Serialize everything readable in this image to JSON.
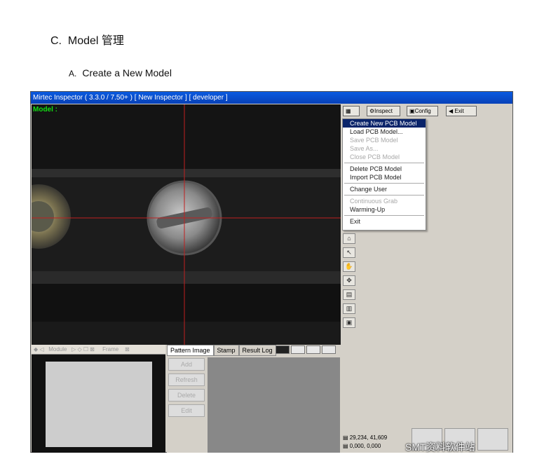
{
  "doc": {
    "heading_num": "C.",
    "heading": "Model 管理",
    "sub_letter": "A.",
    "sub": "Create a New Model"
  },
  "window": {
    "title": "Mirtec Inspector ( 3.3.0 / 7.50+ ) [ New Inspector ] [ developer ]",
    "model_label": "Model :"
  },
  "toolbar": {
    "inspect": "Inspect",
    "config": "Config",
    "exit": "Exit"
  },
  "menu": [
    {
      "label": "Create New PCB Model",
      "state": "selected"
    },
    {
      "label": "Load PCB Model...",
      "state": "enabled"
    },
    {
      "label": "Save PCB Model",
      "state": "disabled"
    },
    {
      "label": "Save As...",
      "state": "disabled"
    },
    {
      "label": "Close PCB Model",
      "state": "disabled"
    },
    {
      "label": "Delete PCB Model",
      "state": "enabled"
    },
    {
      "label": "Import PCB Model",
      "state": "enabled"
    },
    {
      "label": "Change User",
      "state": "enabled"
    },
    {
      "label": "Continuous Grab",
      "state": "disabled"
    },
    {
      "label": "Warming-Up",
      "state": "enabled"
    },
    {
      "label": "Exit",
      "state": "enabled"
    }
  ],
  "bottom_left": {
    "module": "Module",
    "frame": "Frame"
  },
  "tabs": [
    "Pattern Image",
    "Stamp",
    "Result Log"
  ],
  "side_buttons": [
    "Add",
    "Refresh",
    "Delete",
    "Edit"
  ],
  "coords": {
    "line1": "29,234, 41,609",
    "line2": "0,000, 0,000"
  },
  "watermark": "SMT资料软件站"
}
